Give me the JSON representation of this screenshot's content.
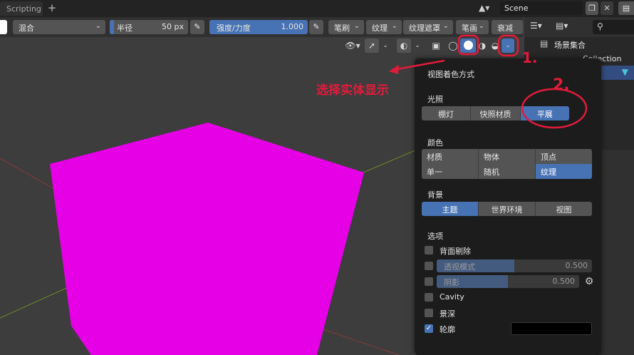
{
  "topbar": {
    "tab_active": "Scripting",
    "tab_add": "+",
    "scene_name": "Scene"
  },
  "toolbar": {
    "blend_mode": "混合",
    "radius_label": "半径",
    "radius_value": "50 px",
    "strength_label": "强度/力度",
    "strength_value": "1.000",
    "strength_fraction": 1.0,
    "brush_menu": "笔刷",
    "texture_menu": "纹理",
    "texture_mask_menu": "纹理遮罩",
    "stroke_menu": "笔画",
    "falloff_menu": "衰减"
  },
  "annotation": {
    "text": "选择实体显示",
    "mark1": "1.",
    "mark2": "2.",
    "color": "#e21b3c"
  },
  "popover": {
    "title": "视图着色方式",
    "lighting": {
      "title": "光照",
      "options": [
        "棚灯",
        "快照材质",
        "平展"
      ],
      "selected": "平展"
    },
    "color": {
      "title": "颜色",
      "row1": [
        "材质",
        "物体",
        "顶点"
      ],
      "row2": [
        "单一",
        "随机",
        "纹理"
      ],
      "selected": "纹理"
    },
    "background": {
      "title": "背景",
      "options": [
        "主题",
        "世界环境",
        "视图"
      ],
      "selected": "主题"
    },
    "options": {
      "title": "选项",
      "backface_culling": "背面剔除",
      "xray_label": "透视模式",
      "xray_value": "0.500",
      "shadow_label": "阴影",
      "shadow_value": "0.500",
      "cavity": "Cavity",
      "dof": "景深",
      "outline": "轮廓",
      "outline_checked": true
    }
  },
  "outliner": {
    "scene_collection": "场景集合",
    "collection": "Collection"
  },
  "colors": {
    "accent": "#4772b3",
    "cube": "#e600e6",
    "viewport_bg": "#3d3d3d"
  }
}
